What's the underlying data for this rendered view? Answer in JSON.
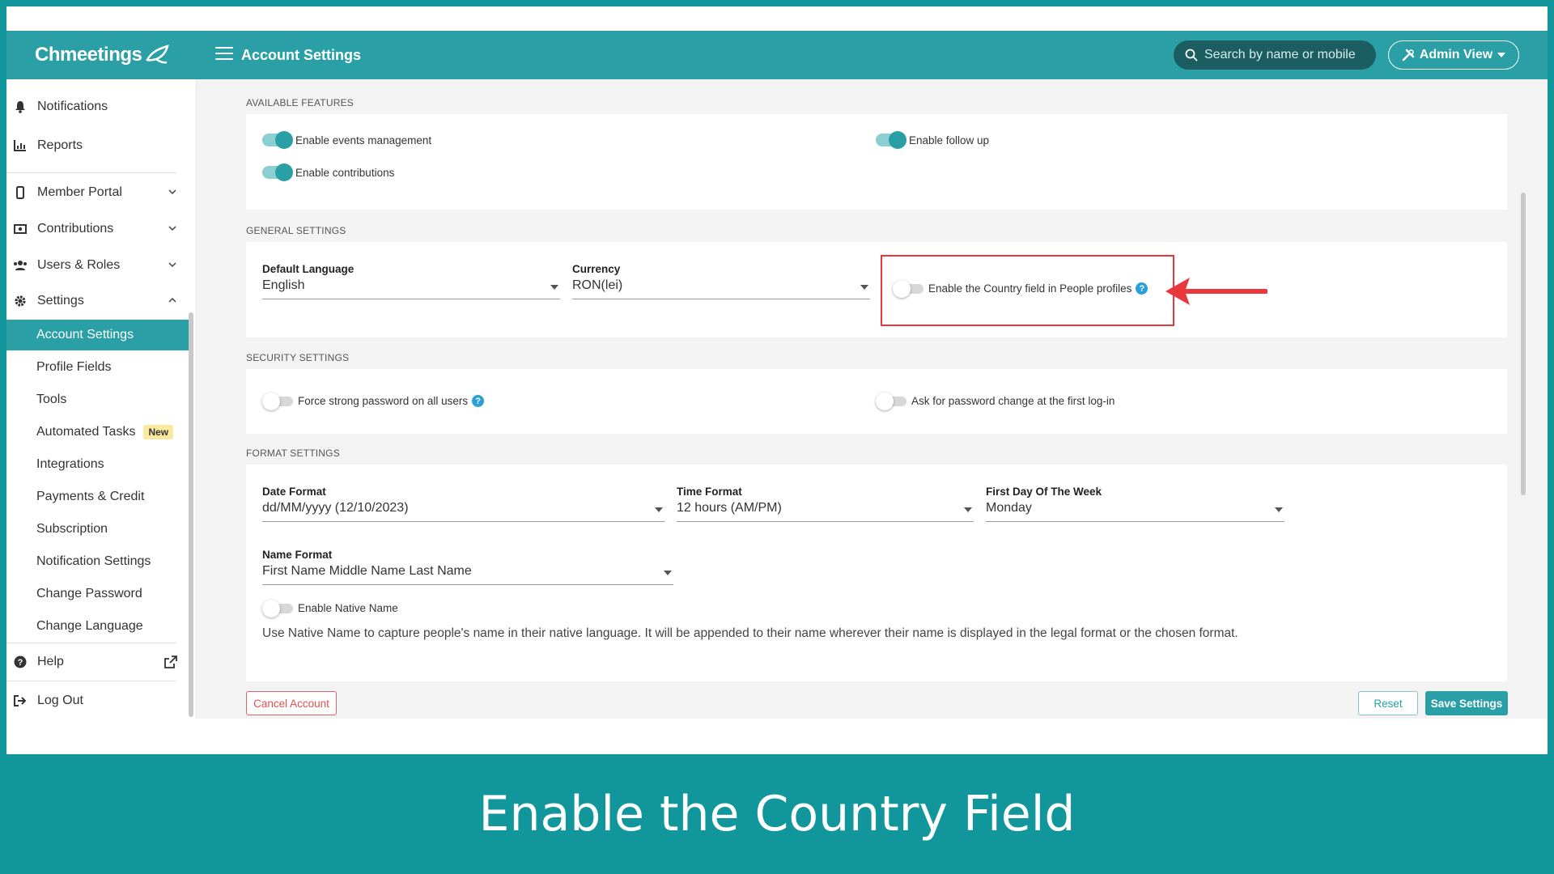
{
  "header": {
    "logo": "Chmeetings",
    "title": "Account Settings",
    "search_placeholder": "Search by name or mobile",
    "admin_view": "Admin View"
  },
  "sidebar": {
    "items": [
      {
        "label": "Notifications",
        "icon": "bell-icon"
      },
      {
        "label": "Reports",
        "icon": "chart-icon"
      },
      {
        "label": "Member Portal",
        "icon": "mobile-icon"
      },
      {
        "label": "Contributions",
        "icon": "money-icon"
      },
      {
        "label": "Users & Roles",
        "icon": "users-icon"
      },
      {
        "label": "Settings",
        "icon": "gear-icon"
      }
    ],
    "settings_sub": [
      "Account Settings",
      "Profile Fields",
      "Tools",
      "Automated Tasks",
      "Integrations",
      "Payments & Credit",
      "Subscription",
      "Notification Settings",
      "Change Password",
      "Change Language"
    ],
    "new_badge": "New",
    "help": "Help",
    "logout": "Log Out"
  },
  "available_features": {
    "title": "AVAILABLE FEATURES",
    "events": "Enable events management",
    "contributions": "Enable contributions",
    "follow_up": "Enable follow up"
  },
  "general_settings": {
    "title": "GENERAL SETTINGS",
    "language_label": "Default Language",
    "language_value": "English",
    "currency_label": "Currency",
    "currency_value": "RON(lei)",
    "country_field": "Enable the Country field in People profiles"
  },
  "security_settings": {
    "title": "SECURITY SETTINGS",
    "strong_password": "Force strong password on all users",
    "password_change": "Ask for password change at the first log-in"
  },
  "format_settings": {
    "title": "FORMAT SETTINGS",
    "date_label": "Date Format",
    "date_value": "dd/MM/yyyy (12/10/2023)",
    "time_label": "Time Format",
    "time_value": "12 hours (AM/PM)",
    "week_label": "First Day Of The Week",
    "week_value": "Monday",
    "name_label": "Name Format",
    "name_value": "First Name Middle Name Last Name",
    "native_name": "Enable Native Name",
    "native_note": "Use Native Name to capture people's name in their native language. It will be appended to their name wherever their name is displayed in the legal format or the chosen format."
  },
  "buttons": {
    "cancel_account": "Cancel Account",
    "reset": "Reset",
    "save": "Save Settings"
  },
  "help_mark": "?",
  "caption": "Enable the Country Field",
  "colors": {
    "teal": "#2a9fa5",
    "background": "#10969b",
    "highlight": "#e8383d"
  }
}
